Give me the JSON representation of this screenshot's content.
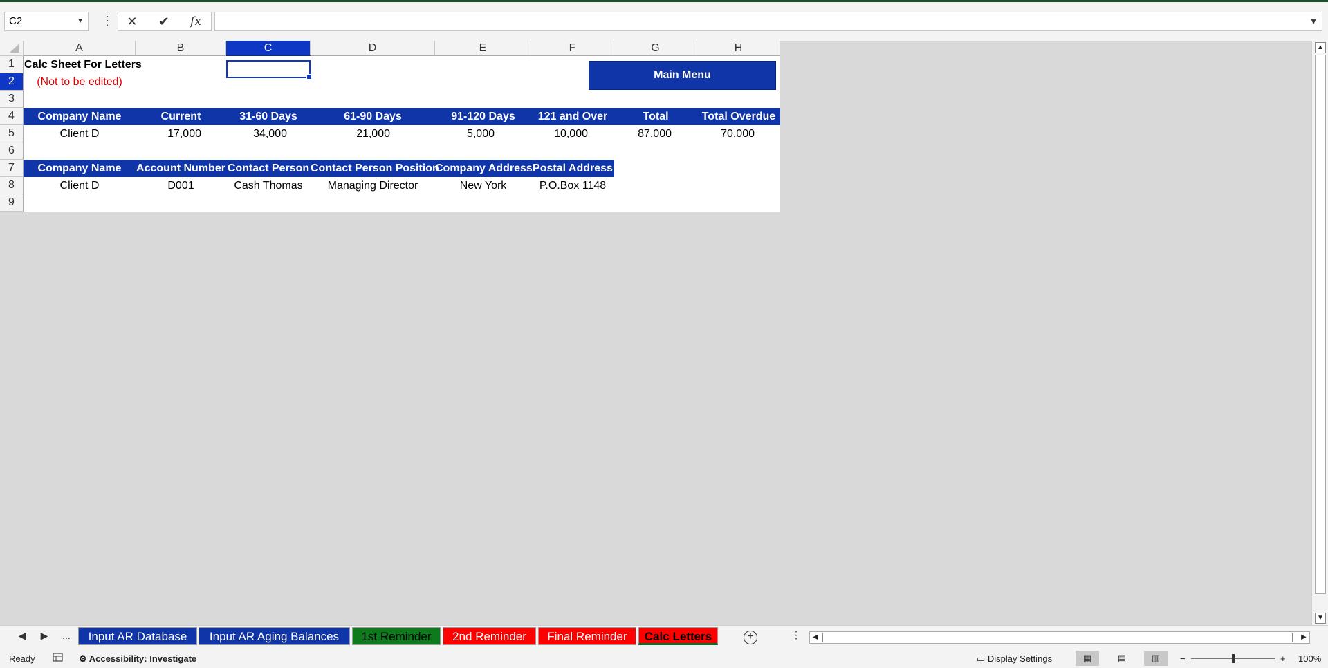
{
  "formula_bar": {
    "name_box": "C2",
    "cancel_icon": "✕",
    "enter_icon": "✔",
    "fx_label": "fx",
    "formula": ""
  },
  "columns": [
    "A",
    "B",
    "C",
    "D",
    "E",
    "F",
    "G",
    "H"
  ],
  "rows": [
    "1",
    "2",
    "3",
    "4",
    "5",
    "6",
    "7",
    "8",
    "9"
  ],
  "selected_column": "C",
  "selected_row": "2",
  "sheet": {
    "title": "Calc Sheet For Letters",
    "subtitle": "(Not to be edited)",
    "main_menu_label": "Main Menu",
    "aging_table": {
      "headers": [
        "Company Name",
        "Current",
        "31-60 Days",
        "61-90 Days",
        "91-120 Days",
        "121 and Over",
        "Total",
        "Total Overdue"
      ],
      "row": [
        "Client D",
        "17,000",
        "34,000",
        "21,000",
        "5,000",
        "10,000",
        "87,000",
        "70,000"
      ]
    },
    "contact_table": {
      "headers": [
        "Company Name",
        "Account Number",
        "Contact Person",
        "Contact Person Position",
        "Company Address",
        "Postal Address"
      ],
      "row": [
        "Client D",
        "D001",
        "Cash Thomas",
        "Managing Director",
        "New York",
        "P.O.Box 1148"
      ]
    }
  },
  "tabs": [
    {
      "label": "Input AR Database",
      "color": "#0f35a8"
    },
    {
      "label": "Input AR Aging Balances",
      "color": "#0f35a8"
    },
    {
      "label": "1st Reminder",
      "color": "#0d7a1e"
    },
    {
      "label": "2nd Reminder",
      "color": "#ff0000"
    },
    {
      "label": "Final Reminder",
      "color": "#ff0000"
    },
    {
      "label": "Calc Letters",
      "color": "#ff0000",
      "active": true
    }
  ],
  "tab_nav": {
    "prev": "◀",
    "next": "▶",
    "more": "..."
  },
  "status": {
    "ready": "Ready",
    "accessibility": "Accessibility: Investigate",
    "display_settings": "Display Settings",
    "zoom_minus": "−",
    "zoom_plus": "+",
    "zoom": "100%",
    "zoom_level_percent": 100
  }
}
